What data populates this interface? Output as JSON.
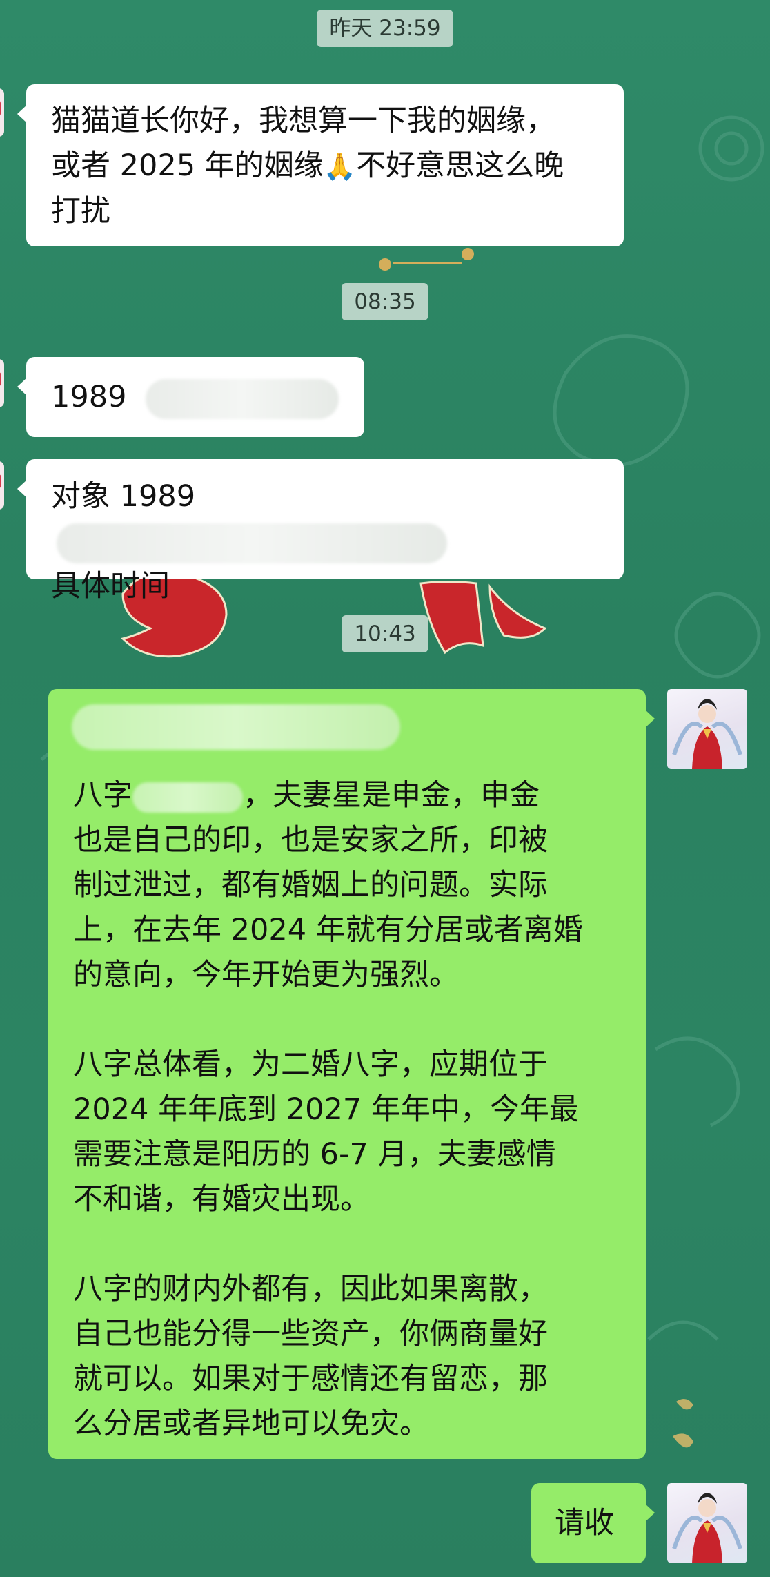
{
  "chat": {
    "timestamps": [
      "昨天 23:59",
      "08:35",
      "10:43"
    ],
    "msg1": "猫猫道长你好，我想算一下我的姻缘，或者 2025 年的姻缘🙏不好意思这么晚打扰",
    "msg1_line1": "猫猫道长你好，我想算一下我的姻缘，",
    "msg1_line2_a": "或者 2025 年的姻缘",
    "msg1_emoji": "🙏",
    "msg1_line2_b": "不好意思这么晚",
    "msg1_line3": "打扰",
    "msg2_visible": "1989",
    "msg3_visible_a": "对象 1989",
    "msg3_visible_b": "具体时间",
    "reply": {
      "p1_lead": "八字",
      "p1_rest": "，夫妻星是申金，申金",
      "p1_lines": [
        "也是自己的印，也是安家之所，印被",
        "制过泄过，都有婚姻上的问题。实际",
        "上，在去年 2024 年就有分居或者离婚",
        "的意向，今年开始更为强烈。"
      ],
      "p2_lines": [
        "八字总体看，为二婚八字，应期位于",
        "2024 年年底到 2027 年年中，今年最",
        "需要注意是阳历的 6-7 月，夫妻感情",
        "不和谐，有婚灾出现。"
      ],
      "p3_lines": [
        "八字的财内外都有，因此如果离散，",
        "自己也能分得一些资产，你俩商量好",
        "就可以。如果对于感情还有留恋，那",
        "么分居或者异地可以免灾。"
      ]
    },
    "last_reply": "请收"
  },
  "colors": {
    "background": "#2c8463",
    "bubble_left": "#ffffff",
    "bubble_right": "#95ec69",
    "timestamp_bg": "#b7d3c6"
  }
}
